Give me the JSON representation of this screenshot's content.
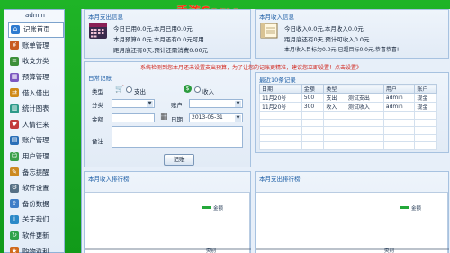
{
  "watermark": "手游Game",
  "sidebar": {
    "user": "admin",
    "items": [
      {
        "label": "记账首页",
        "icon": "home-icon",
        "color": "#2e7bd0",
        "glyph": "⌂"
      },
      {
        "label": "账单管理",
        "icon": "bill-icon",
        "color": "#c85a22",
        "glyph": "¥"
      },
      {
        "label": "收支分类",
        "icon": "category-icon",
        "color": "#3d8f3a",
        "glyph": "≡"
      },
      {
        "label": "预算管理",
        "icon": "budget-icon",
        "color": "#7c57c0",
        "glyph": "▦"
      },
      {
        "label": "借入借出",
        "icon": "loan-icon",
        "color": "#d08a18",
        "glyph": "⇄"
      },
      {
        "label": "统计图表",
        "icon": "chart-icon",
        "color": "#2d9a8a",
        "glyph": "▥"
      },
      {
        "label": "人情往来",
        "icon": "people-icon",
        "color": "#c23b3b",
        "glyph": "♥"
      },
      {
        "label": "账户管理",
        "icon": "account-icon",
        "color": "#2a6fb8",
        "glyph": "▤"
      },
      {
        "label": "用户管理",
        "icon": "user-icon",
        "color": "#3aa04a",
        "glyph": "☺"
      },
      {
        "label": "备忘提醒",
        "icon": "memo-icon",
        "color": "#cc8a22",
        "glyph": "✎"
      },
      {
        "label": "软件设置",
        "icon": "settings-icon",
        "color": "#557086",
        "glyph": "⚙"
      },
      {
        "label": "备份数据",
        "icon": "backup-icon",
        "color": "#3f7ec8",
        "glyph": "⇪"
      },
      {
        "label": "关于我们",
        "icon": "about-icon",
        "color": "#2b89c8",
        "glyph": "i"
      },
      {
        "label": "软件更新",
        "icon": "update-icon",
        "color": "#2fa24a",
        "glyph": "↻"
      },
      {
        "label": "购物返利",
        "icon": "shopping-icon",
        "color": "#d06a1c",
        "glyph": "★"
      }
    ]
  },
  "expense_info": {
    "title": "本月支出信息",
    "line1": "今日已用0.0元,本月已用0.0元",
    "line2": "本月预算0.0元,本月还有0.0元可用",
    "line3": "距月底还有0天,预计还需消费0.00元",
    "icon": "calendar-icon"
  },
  "income_info": {
    "title": "本月收入信息",
    "line1": "今日收入0.0元,本月收入0.0元",
    "line2": "距月底还有0天,预计可收入0.0元",
    "line3": "本月收入目标为0.0元,已超目标0.0元,恭喜恭喜!",
    "icon": "notebook-icon"
  },
  "daily_record": {
    "title": "日常记账",
    "warning": "系统检测到您本月还未设置支出预算，为了让您的记账更精准，建议您立即设置！点击设置》",
    "type_label": "类型",
    "expense_label": "支出",
    "income_label": "收入",
    "category_label": "分类",
    "account_label": "账户",
    "amount_label": "金额",
    "date_label": "日期",
    "date_value": "2013-05-31",
    "note_label": "备注",
    "submit_label": "记账"
  },
  "recent_records": {
    "title": "最近10条记录",
    "headers": [
      "日期",
      "金额",
      "类型",
      "用户",
      "账户"
    ],
    "rows": [
      [
        "11月20号",
        "500",
        "支出",
        "测试支出",
        "admin",
        "现金"
      ],
      [
        "11月20号",
        "300",
        "收入",
        "测试收入",
        "admin",
        "现金"
      ]
    ]
  },
  "income_ranking": {
    "title": "本月收入排行榜",
    "legend": "金额",
    "xlabel": "类别"
  },
  "expense_ranking": {
    "title": "本月支出排行榜",
    "legend": "金额",
    "xlabel": "类别"
  }
}
